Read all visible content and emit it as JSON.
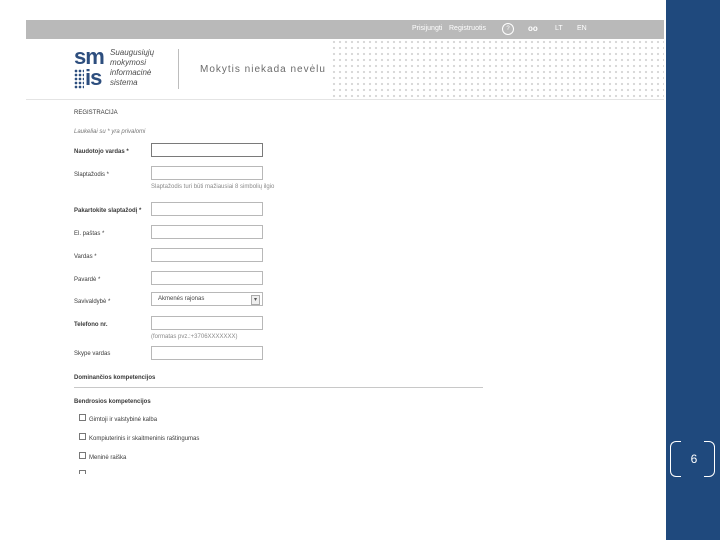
{
  "topbar": {
    "login": "Prisijungti",
    "register": "Registruotis",
    "help_icon": "?",
    "eyes_icon": "oo",
    "lang_lt": "LT",
    "lang_en": "EN"
  },
  "logo": {
    "mark_top": "sm",
    "mark_bottom": "is",
    "line1": "Suaugusiųjų",
    "line2": "mokymosi",
    "line3": "informacinė",
    "line4": "sistema",
    "slogan": "Mokytis niekada nevėlu"
  },
  "form": {
    "heading": "REGISTRACIJA",
    "required_note": "Laukeliai su * yra privalomi",
    "fields": {
      "username": {
        "label": "Naudotojo vardas *"
      },
      "password": {
        "label": "Slaptažodis *",
        "hint": "Slaptažodis turi būti mažiausiai 8 simbolių ilgio"
      },
      "password_repeat": {
        "label": "Pakartokite slaptažodį *"
      },
      "email": {
        "label": "El. paštas *"
      },
      "first_name": {
        "label": "Vardas *"
      },
      "last_name": {
        "label": "Pavardė *"
      },
      "municipality": {
        "label": "Savivaldybė *",
        "value": "Akmenės rajonas"
      },
      "phone": {
        "label": "Telefono nr.",
        "hint": "(formatas pvz.:+3706XXXXXXX)"
      },
      "skype": {
        "label": "Skype vardas"
      }
    },
    "section_teaching": "Dominančios kompetencijos",
    "section_general": "Bendrosios kompetencijos",
    "competences": [
      {
        "label": "Gimtoji ir valstybinė kalba",
        "checked": false
      },
      {
        "label": "Kompiuterinis ir skaitmeninis raštingumas",
        "checked": false
      },
      {
        "label": "Meninė raiška",
        "checked": false
      },
      {
        "label": "",
        "checked": false
      }
    ]
  },
  "slide": {
    "number": "6"
  },
  "colors": {
    "side_panel": "#1f497d",
    "brand": "#2d4e7e",
    "topbar": "#b9b9b9"
  }
}
